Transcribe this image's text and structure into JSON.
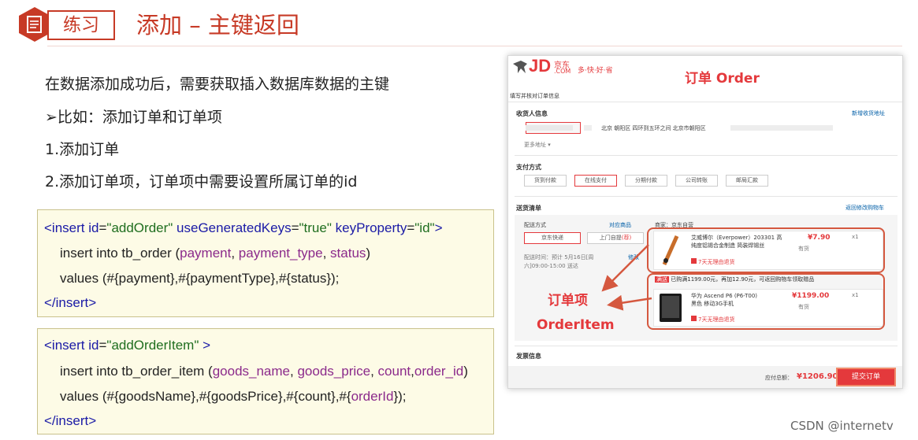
{
  "header": {
    "tag": "练习",
    "title": "添加 – 主键返回"
  },
  "body_text": {
    "line1": "在数据添加成功后，需要获取插入数据库数据的主键",
    "line2": "➢比如：添加订单和订单项",
    "line3": "1.添加订单",
    "line4": "2.添加订单项，订单项中需要设置所属订单的id"
  },
  "code1": {
    "l1_open": "<insert ",
    "l1_attr1": "id",
    "l1_val1": "\"addOrder\"",
    "l1_attr2": "useGeneratedKeys",
    "l1_val2": "\"true\"",
    "l1_attr3": "keyProperty",
    "l1_val3": "\"id\"",
    "l1_close": ">",
    "l2_a": "insert into tb_order (",
    "l2_f1": "payment",
    "l2_c1": ", ",
    "l2_f2": "payment_type",
    "l2_c2": ", ",
    "l2_f3": "status",
    "l2_b": ")",
    "l3": "values (#{payment},#{paymentType},#{status});",
    "l4": "</insert>"
  },
  "code2": {
    "l1_open": "<insert ",
    "l1_attr1": "id",
    "l1_val1": "\"addOrderItem\"",
    "l1_close": " >",
    "l2_a": "insert into tb_order_item (",
    "l2_f1": "goods_name",
    "l2_c1": ", ",
    "l2_f2": "goods_price",
    "l2_c2": ", ",
    "l2_f3": "count",
    "l2_c3": ",",
    "l2_f4": "order_id",
    "l2_b": ")",
    "l3_a": "values (#{goodsName},#{goodsPrice},#{count},#{",
    "l3_f": "orderId",
    "l3_b": "});",
    "l4": "</insert>"
  },
  "jd": {
    "logo": "JD",
    "logo_cn": "京东",
    "logo_com": ".COM",
    "slogan": "多·快·好·省",
    "annotation_order": "订单 Order",
    "page_heading": "填写并核对订单信息",
    "recipient_label": "收货人信息",
    "new_address": "新增收货地址",
    "address": "北京 朝阳区 四环到五环之间 北京市朝阳区",
    "more_address": "更多地址 ▾",
    "payment_label": "支付方式",
    "payment_options": [
      "货到付款",
      "在线支付",
      "分期付款",
      "公司转账",
      "邮局汇款"
    ],
    "delivery_label": "送货清单",
    "back_cart": "返回修改购物车",
    "ship_method": "配送方式",
    "ship_goods": "对应商品",
    "seller": "商家：京东自营",
    "ship_opts": [
      "京东快递",
      "上门自提"
    ],
    "ship_badge": "(荐)",
    "ship_time": "配送时间：预计 5月16日[周六]09:00-15:00 送达",
    "modify": "修改",
    "item1_name": "艾威博尔（Everpower）203301 高纯度铝锡合金制造 简装焊锡丝",
    "item1_price": "¥7.90",
    "item1_qty": "x1",
    "item1_stock": "有货",
    "item1_return": "7天无理由退货",
    "promo_tag": "满送",
    "promo": "已购满1199.00元，再加12.90元，可返回购物车领取赠品",
    "item2_name": "华为 Ascend P6 (P6-T00) 黑色 移动3G手机",
    "item2_price": "¥1199.00",
    "item2_qty": "x1",
    "item2_stock": "有货",
    "item2_return": "7天无理由退货",
    "annotation_item_cn": "订单项",
    "annotation_item_en": "OrderItem",
    "invoice_label": "发票信息",
    "total_label": "应付总额：",
    "total_value": "¥1206.90",
    "submit": "提交订单"
  },
  "watermark": "CSDN @internetv",
  "colors": {
    "accent": "#c73a26",
    "jd_red": "#e4393c",
    "code_bg": "#fdfbe6"
  }
}
